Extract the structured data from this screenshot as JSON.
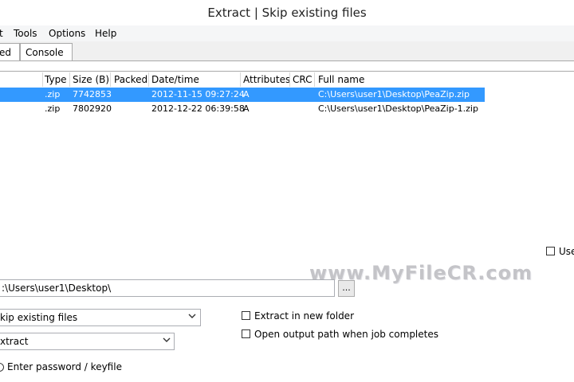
{
  "window": {
    "title": "Extract | Skip existing files"
  },
  "menu": {
    "items": [
      "t",
      "Tools",
      "Options",
      "Help"
    ]
  },
  "tabs": [
    "ed",
    "Console"
  ],
  "list": {
    "columns": [
      "Type",
      "Size (B)",
      "Packed",
      "Date/time",
      "Attributes",
      "CRC",
      "Full name"
    ],
    "rows": [
      {
        "type": ".zip",
        "size": "7742853",
        "packed": "",
        "datetime": "2012-11-15 09:27:24",
        "attributes": "A",
        "crc": "",
        "fullname": "C:\\Users\\user1\\Desktop\\PeaZip.zip",
        "selected": true
      },
      {
        "type": ".zip",
        "size": "7802920",
        "packed": "",
        "datetime": "2012-12-22 06:39:58",
        "attributes": "A",
        "crc": "",
        "fullname": "C:\\Users\\user1\\Desktop\\PeaZip-1.zip",
        "selected": false
      }
    ]
  },
  "options": {
    "use_label": "Use",
    "output_path": ":\\Users\\user1\\Desktop\\",
    "browse_label": "...",
    "overwrite_select": "kip existing files",
    "mode_select": "xtract",
    "extract_new_folder": "Extract in new folder",
    "open_output_path": "Open output path when job completes",
    "password_label": "Enter password / keyfile"
  },
  "watermark": "www.MyFileCR.com",
  "colors": {
    "selection": "#3399ff",
    "tab_border": "#a9a9a9"
  },
  "icons": [
    "chevron-down-icon",
    "radio-icon"
  ]
}
